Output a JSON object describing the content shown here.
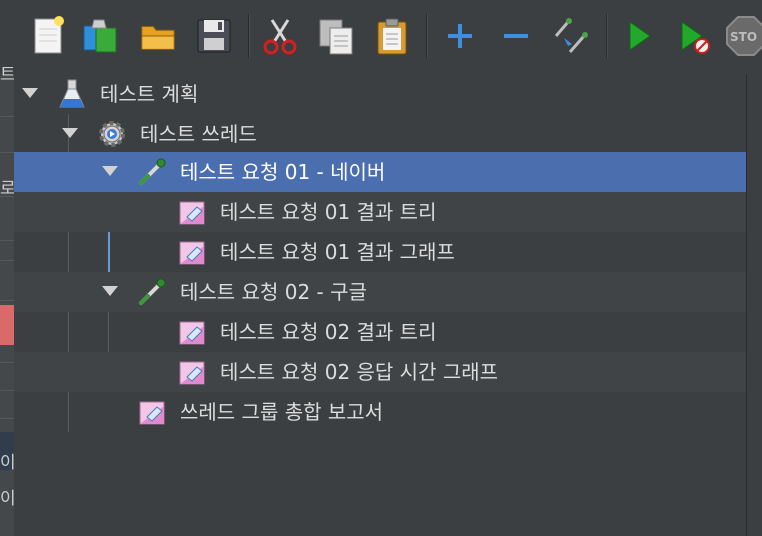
{
  "toolbar": {
    "buttons": [
      {
        "id": "new",
        "icon": "new-document-icon"
      },
      {
        "id": "templates",
        "icon": "templates-icon"
      },
      {
        "id": "open",
        "icon": "open-folder-icon"
      },
      {
        "id": "save",
        "icon": "save-floppy-icon"
      },
      {
        "id": "cut",
        "icon": "scissors-icon"
      },
      {
        "id": "copy",
        "icon": "copy-icon"
      },
      {
        "id": "paste",
        "icon": "paste-clipboard-icon"
      },
      {
        "id": "expand",
        "icon": "plus-icon"
      },
      {
        "id": "collapse",
        "icon": "minus-icon"
      },
      {
        "id": "toggle",
        "icon": "toggle-pipette-icon"
      },
      {
        "id": "start",
        "icon": "play-icon"
      },
      {
        "id": "start-no-pause",
        "icon": "play-no-timer-icon"
      },
      {
        "id": "stop",
        "icon": "stop-sign-icon",
        "label": "STO"
      }
    ]
  },
  "left_strip": {
    "chars": [
      "트",
      "로",
      "이",
      "이"
    ]
  },
  "tree": {
    "items": [
      {
        "label": "테스트 계획",
        "icon": "flask-icon"
      },
      {
        "label": "테스트 쓰레드",
        "icon": "gear-icon"
      },
      {
        "label": "테스트 요청 01 - 네이버",
        "icon": "pipette-icon"
      },
      {
        "label": "테스트 요청 01 결과 트리",
        "icon": "chart-listener-icon"
      },
      {
        "label": "테스트 요청 01 결과 그래프",
        "icon": "chart-listener-icon"
      },
      {
        "label": "테스트 요청 02 - 구글",
        "icon": "pipette-icon"
      },
      {
        "label": "테스트 요청 02 결과 트리",
        "icon": "chart-listener-icon"
      },
      {
        "label": "테스트 요청 02 응답 시간 그래프",
        "icon": "chart-listener-icon"
      },
      {
        "label": "쓰레드 그룹 총합 보고서",
        "icon": "chart-listener-icon"
      }
    ]
  },
  "colors": {
    "selection": "#4b6eaf",
    "background": "#3c3f41",
    "text": "#dcdcdc"
  }
}
